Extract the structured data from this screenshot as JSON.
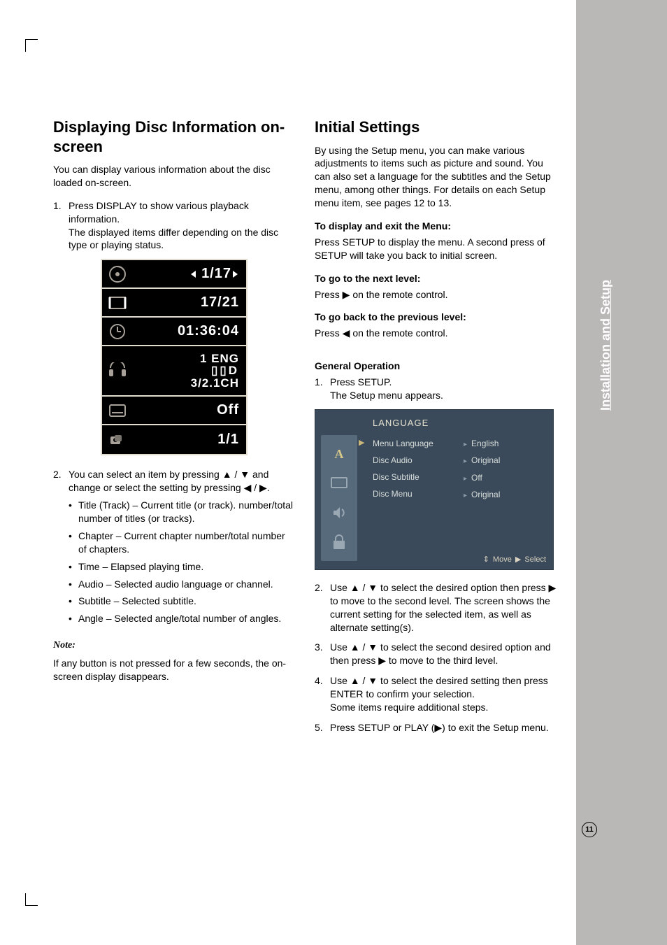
{
  "page_number": "11",
  "sidebar_label": "Installation and Setup",
  "left": {
    "heading": "Displaying Disc Information on-screen",
    "intro": "You can display various information about the disc loaded on-screen.",
    "step1_a": "Press DISPLAY to show various playback information.",
    "step1_b": "The displayed items differ depending on the disc type or playing status.",
    "osd": {
      "title": "1/17",
      "chapter": "17/21",
      "time": "01:36:04",
      "audio_line1": "1 ENG",
      "audio_line2": "D D",
      "audio_line3": "3/2.1CH",
      "subtitle": "Off",
      "angle": "1/1"
    },
    "step2_a": "You can select an item by pressing ▲ / ▼ and change or select the setting by pressing ◀ / ▶.",
    "bullets": [
      "Title (Track) – Current title (or track). number/total number of titles (or tracks).",
      "Chapter – Current chapter number/total number of chapters.",
      "Time – Elapsed playing time.",
      "Audio – Selected audio language or channel.",
      "Subtitle – Selected subtitle.",
      "Angle – Selected angle/total number of angles."
    ],
    "note_h": "Note:",
    "note": "If any button is not pressed for a few seconds, the on-screen display disappears."
  },
  "right": {
    "heading": "Initial Settings",
    "intro": "By using the Setup menu, you can make various adjustments to items such as picture and sound. You can also set a language for the subtitles and the Setup menu, among other things. For details on each Setup menu item, see pages 12 to 13.",
    "sub1_h": "To display and exit the Menu:",
    "sub1_p": "Press SETUP to display the menu. A second press of SETUP will take you back to initial screen.",
    "sub2_h": "To go to the next level:",
    "sub2_p": "Press ▶ on the remote control.",
    "sub3_h": "To go back to the previous level:",
    "sub3_p": "Press ◀ on the remote control.",
    "genop_h": "General Operation",
    "genop_1": "Press SETUP.",
    "genop_1b": "The Setup menu appears.",
    "osd2": {
      "title": "LANGUAGE",
      "items": [
        "Menu Language",
        "Disc Audio",
        "Disc Subtitle",
        "Disc Menu"
      ],
      "values": [
        "English",
        "Original",
        "Off",
        "Original"
      ],
      "footer_move": "Move",
      "footer_select": "Select"
    },
    "genop_2": "Use ▲ / ▼ to select the desired option then press ▶ to move to the second level. The screen shows the current setting for the selected item, as well as alternate setting(s).",
    "genop_3": "Use ▲ / ▼ to select the second desired option and then press ▶ to move to the third level.",
    "genop_4a": "Use ▲ / ▼ to select the desired setting then press ENTER to confirm your selection.",
    "genop_4b": "Some items require additional steps.",
    "genop_5": "Press SETUP or PLAY (▶) to exit the Setup menu."
  }
}
